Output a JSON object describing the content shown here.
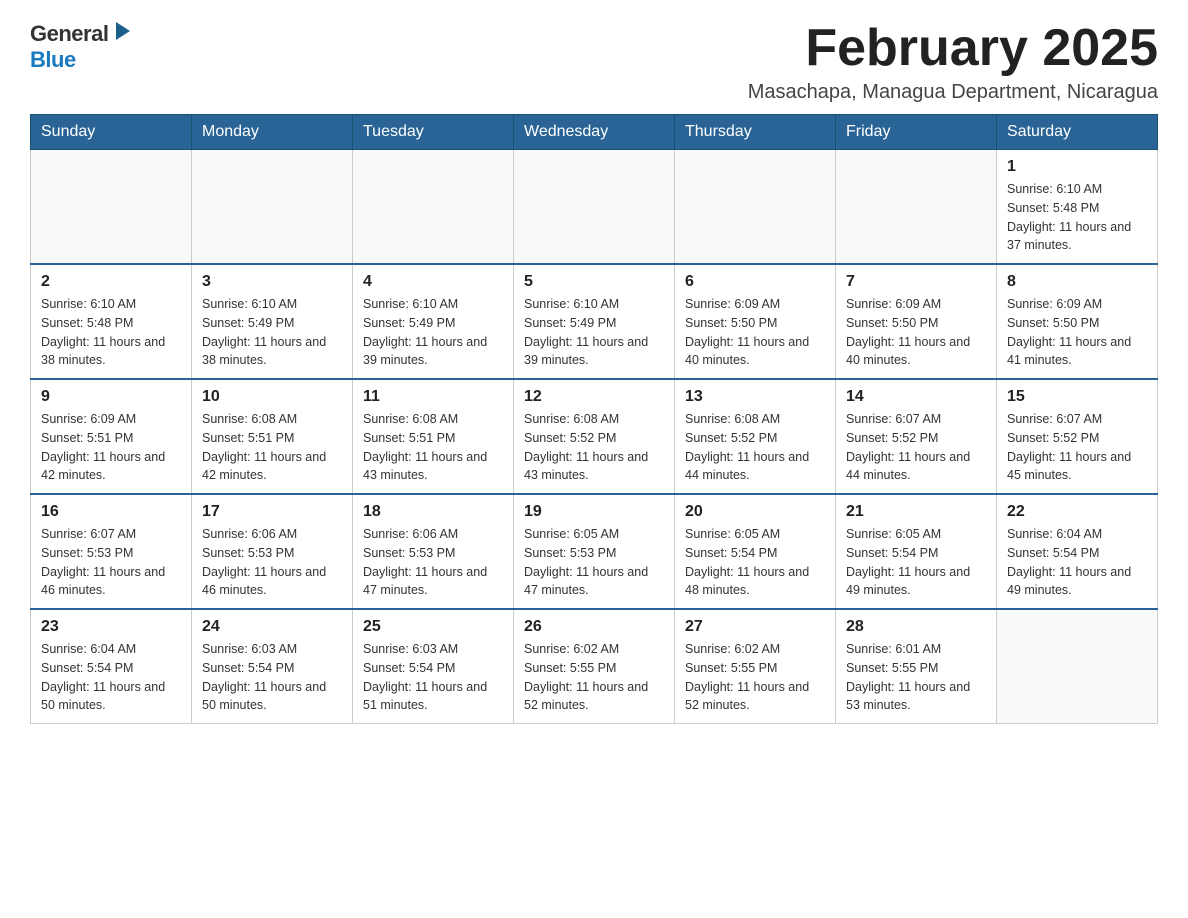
{
  "logo": {
    "general": "General",
    "blue": "Blue",
    "arrow": "▶"
  },
  "title": {
    "month": "February 2025",
    "location": "Masachapa, Managua Department, Nicaragua"
  },
  "weekdays": [
    "Sunday",
    "Monday",
    "Tuesday",
    "Wednesday",
    "Thursday",
    "Friday",
    "Saturday"
  ],
  "weeks": [
    [
      {
        "day": "",
        "sunrise": "",
        "sunset": "",
        "daylight": ""
      },
      {
        "day": "",
        "sunrise": "",
        "sunset": "",
        "daylight": ""
      },
      {
        "day": "",
        "sunrise": "",
        "sunset": "",
        "daylight": ""
      },
      {
        "day": "",
        "sunrise": "",
        "sunset": "",
        "daylight": ""
      },
      {
        "day": "",
        "sunrise": "",
        "sunset": "",
        "daylight": ""
      },
      {
        "day": "",
        "sunrise": "",
        "sunset": "",
        "daylight": ""
      },
      {
        "day": "1",
        "sunrise": "Sunrise: 6:10 AM",
        "sunset": "Sunset: 5:48 PM",
        "daylight": "Daylight: 11 hours and 37 minutes."
      }
    ],
    [
      {
        "day": "2",
        "sunrise": "Sunrise: 6:10 AM",
        "sunset": "Sunset: 5:48 PM",
        "daylight": "Daylight: 11 hours and 38 minutes."
      },
      {
        "day": "3",
        "sunrise": "Sunrise: 6:10 AM",
        "sunset": "Sunset: 5:49 PM",
        "daylight": "Daylight: 11 hours and 38 minutes."
      },
      {
        "day": "4",
        "sunrise": "Sunrise: 6:10 AM",
        "sunset": "Sunset: 5:49 PM",
        "daylight": "Daylight: 11 hours and 39 minutes."
      },
      {
        "day": "5",
        "sunrise": "Sunrise: 6:10 AM",
        "sunset": "Sunset: 5:49 PM",
        "daylight": "Daylight: 11 hours and 39 minutes."
      },
      {
        "day": "6",
        "sunrise": "Sunrise: 6:09 AM",
        "sunset": "Sunset: 5:50 PM",
        "daylight": "Daylight: 11 hours and 40 minutes."
      },
      {
        "day": "7",
        "sunrise": "Sunrise: 6:09 AM",
        "sunset": "Sunset: 5:50 PM",
        "daylight": "Daylight: 11 hours and 40 minutes."
      },
      {
        "day": "8",
        "sunrise": "Sunrise: 6:09 AM",
        "sunset": "Sunset: 5:50 PM",
        "daylight": "Daylight: 11 hours and 41 minutes."
      }
    ],
    [
      {
        "day": "9",
        "sunrise": "Sunrise: 6:09 AM",
        "sunset": "Sunset: 5:51 PM",
        "daylight": "Daylight: 11 hours and 42 minutes."
      },
      {
        "day": "10",
        "sunrise": "Sunrise: 6:08 AM",
        "sunset": "Sunset: 5:51 PM",
        "daylight": "Daylight: 11 hours and 42 minutes."
      },
      {
        "day": "11",
        "sunrise": "Sunrise: 6:08 AM",
        "sunset": "Sunset: 5:51 PM",
        "daylight": "Daylight: 11 hours and 43 minutes."
      },
      {
        "day": "12",
        "sunrise": "Sunrise: 6:08 AM",
        "sunset": "Sunset: 5:52 PM",
        "daylight": "Daylight: 11 hours and 43 minutes."
      },
      {
        "day": "13",
        "sunrise": "Sunrise: 6:08 AM",
        "sunset": "Sunset: 5:52 PM",
        "daylight": "Daylight: 11 hours and 44 minutes."
      },
      {
        "day": "14",
        "sunrise": "Sunrise: 6:07 AM",
        "sunset": "Sunset: 5:52 PM",
        "daylight": "Daylight: 11 hours and 44 minutes."
      },
      {
        "day": "15",
        "sunrise": "Sunrise: 6:07 AM",
        "sunset": "Sunset: 5:52 PM",
        "daylight": "Daylight: 11 hours and 45 minutes."
      }
    ],
    [
      {
        "day": "16",
        "sunrise": "Sunrise: 6:07 AM",
        "sunset": "Sunset: 5:53 PM",
        "daylight": "Daylight: 11 hours and 46 minutes."
      },
      {
        "day": "17",
        "sunrise": "Sunrise: 6:06 AM",
        "sunset": "Sunset: 5:53 PM",
        "daylight": "Daylight: 11 hours and 46 minutes."
      },
      {
        "day": "18",
        "sunrise": "Sunrise: 6:06 AM",
        "sunset": "Sunset: 5:53 PM",
        "daylight": "Daylight: 11 hours and 47 minutes."
      },
      {
        "day": "19",
        "sunrise": "Sunrise: 6:05 AM",
        "sunset": "Sunset: 5:53 PM",
        "daylight": "Daylight: 11 hours and 47 minutes."
      },
      {
        "day": "20",
        "sunrise": "Sunrise: 6:05 AM",
        "sunset": "Sunset: 5:54 PM",
        "daylight": "Daylight: 11 hours and 48 minutes."
      },
      {
        "day": "21",
        "sunrise": "Sunrise: 6:05 AM",
        "sunset": "Sunset: 5:54 PM",
        "daylight": "Daylight: 11 hours and 49 minutes."
      },
      {
        "day": "22",
        "sunrise": "Sunrise: 6:04 AM",
        "sunset": "Sunset: 5:54 PM",
        "daylight": "Daylight: 11 hours and 49 minutes."
      }
    ],
    [
      {
        "day": "23",
        "sunrise": "Sunrise: 6:04 AM",
        "sunset": "Sunset: 5:54 PM",
        "daylight": "Daylight: 11 hours and 50 minutes."
      },
      {
        "day": "24",
        "sunrise": "Sunrise: 6:03 AM",
        "sunset": "Sunset: 5:54 PM",
        "daylight": "Daylight: 11 hours and 50 minutes."
      },
      {
        "day": "25",
        "sunrise": "Sunrise: 6:03 AM",
        "sunset": "Sunset: 5:54 PM",
        "daylight": "Daylight: 11 hours and 51 minutes."
      },
      {
        "day": "26",
        "sunrise": "Sunrise: 6:02 AM",
        "sunset": "Sunset: 5:55 PM",
        "daylight": "Daylight: 11 hours and 52 minutes."
      },
      {
        "day": "27",
        "sunrise": "Sunrise: 6:02 AM",
        "sunset": "Sunset: 5:55 PM",
        "daylight": "Daylight: 11 hours and 52 minutes."
      },
      {
        "day": "28",
        "sunrise": "Sunrise: 6:01 AM",
        "sunset": "Sunset: 5:55 PM",
        "daylight": "Daylight: 11 hours and 53 minutes."
      },
      {
        "day": "",
        "sunrise": "",
        "sunset": "",
        "daylight": ""
      }
    ]
  ]
}
